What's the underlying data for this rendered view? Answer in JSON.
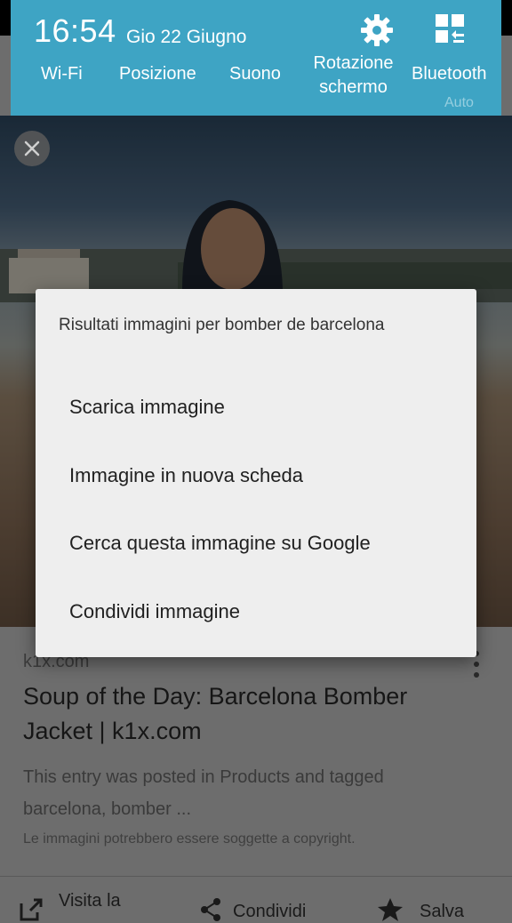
{
  "quick_settings": {
    "time": "16:54",
    "date": "Gio 22 Giugno",
    "tiles": [
      {
        "label": "Wi-Fi"
      },
      {
        "label": "Posizione"
      },
      {
        "label": "Suono"
      },
      {
        "label": "Rotazione\nschermo"
      },
      {
        "label": "Bluetooth"
      }
    ],
    "auto_label": "Auto",
    "background_color": "#3ea4c4"
  },
  "result_card": {
    "source": "k1x.com",
    "title": "Soup of the Day: Barcelona Bomber Jacket | k1x.com",
    "description": "This entry was posted in Products and tagged barcelona, bomber ...",
    "copyright_notice": "Le immagini potrebbero essere soggette a copyright.",
    "actions": {
      "visit": "Visita la",
      "share": "Condividi",
      "save": "Salva"
    }
  },
  "context_menu": {
    "title": "Risultati immagini per bomber de barcelona",
    "items": [
      {
        "label": "Scarica immagine"
      },
      {
        "label": "Immagine in nuova scheda"
      },
      {
        "label": "Cerca questa immagine su Google"
      },
      {
        "label": "Condividi immagine"
      }
    ]
  }
}
